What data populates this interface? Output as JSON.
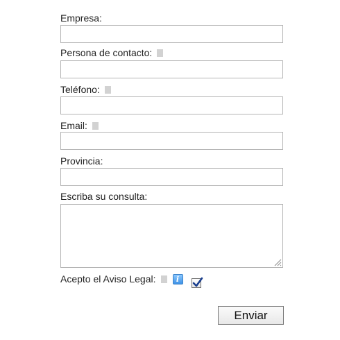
{
  "form": {
    "company": {
      "label": "Empresa:",
      "value": "",
      "required": false
    },
    "contact_person": {
      "label": "Persona de contacto:",
      "value": "",
      "required": true
    },
    "phone": {
      "label": "Teléfono:",
      "value": "",
      "required": true
    },
    "email": {
      "label": "Email:",
      "value": "",
      "required": true
    },
    "province": {
      "label": "Provincia:",
      "value": "",
      "required": false
    },
    "inquiry": {
      "label": "Escriba su consulta:",
      "value": ""
    },
    "legal_notice": {
      "label": "Acepto el Aviso Legal:",
      "info_icon": "info-icon",
      "info_glyph": "i",
      "checked": true
    },
    "submit_label": "Enviar"
  },
  "colors": {
    "required_marker": "#d2d2d2",
    "input_border": "#b4b4b4",
    "info_icon": "#3f93e6",
    "checkmark": "#1a3f8f"
  }
}
